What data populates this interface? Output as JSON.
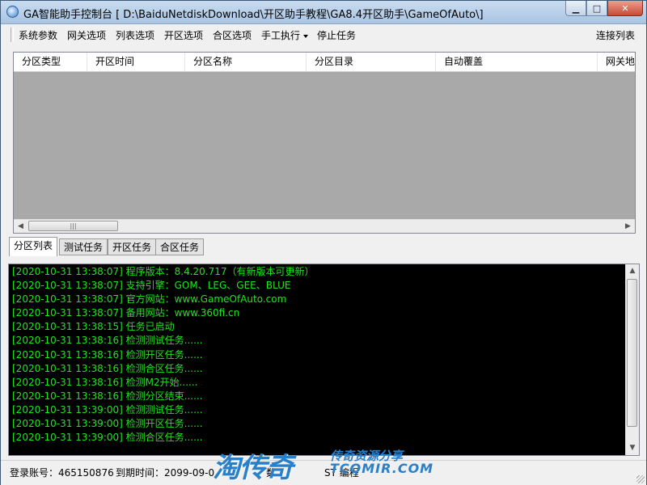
{
  "window": {
    "title": "GA智能助手控制台 [ D:\\BaiduNetdiskDownload\\开区助手教程\\GA8.4开区助手\\GameOfAuto\\]",
    "minimize_glyph": "▁",
    "maximize_glyph": "□",
    "close_glyph": "✕"
  },
  "menu": {
    "items": [
      {
        "label": "系统参数"
      },
      {
        "label": "网关选项"
      },
      {
        "label": "列表选项"
      },
      {
        "label": "开区选项"
      },
      {
        "label": "合区选项"
      },
      {
        "label": "手工执行"
      },
      {
        "label": "停止任务"
      }
    ],
    "right_label": "连接列表"
  },
  "listview": {
    "columns": [
      "分区类型",
      "开区时间",
      "分区名称",
      "分区目录",
      "自动覆盖",
      "网关地址"
    ],
    "scroll_left_glyph": "◀",
    "scroll_right_glyph": "▶",
    "thumb_grip": "|||"
  },
  "tabs": [
    "分区列表",
    "测试任务",
    "开区任务",
    "合区任务"
  ],
  "log": {
    "color": "#1ee61e",
    "lines": [
      "[2020-10-31 13:38:07] 程序版本：8.4.20.717（有新版本可更新）",
      "[2020-10-31 13:38:07] 支持引擎：GOM、LEG、GEE、BLUE",
      "[2020-10-31 13:38:07] 官方网站：www.GameOfAuto.com",
      "[2020-10-31 13:38:07] 备用网站：www.360fi.cn",
      "[2020-10-31 13:38:15] 任务已启动",
      "[2020-10-31 13:38:16] 检测测试任务......",
      "[2020-10-31 13:38:16] 检测开区任务......",
      "[2020-10-31 13:38:16] 检测合区任务......",
      "[2020-10-31 13:38:16] 检测M2开始......",
      "[2020-10-31 13:38:16] 检测分区结束......",
      "[2020-10-31 13:39:00] 检测测试任务......",
      "[2020-10-31 13:39:00] 检测开区任务......",
      "[2020-10-31 13:39:00] 检测合区任务......"
    ],
    "scroll_up_glyph": "▲",
    "scroll_down_glyph": "▼"
  },
  "status": {
    "account": "登录账号：465150876",
    "expiry": "到期时间：2099-09-0",
    "tail1": "数",
    "tail2": "ST 编程"
  },
  "watermark": {
    "big": "淘传奇",
    "line1": "传奇资源分享",
    "line2": "TCQMIR.COM"
  }
}
